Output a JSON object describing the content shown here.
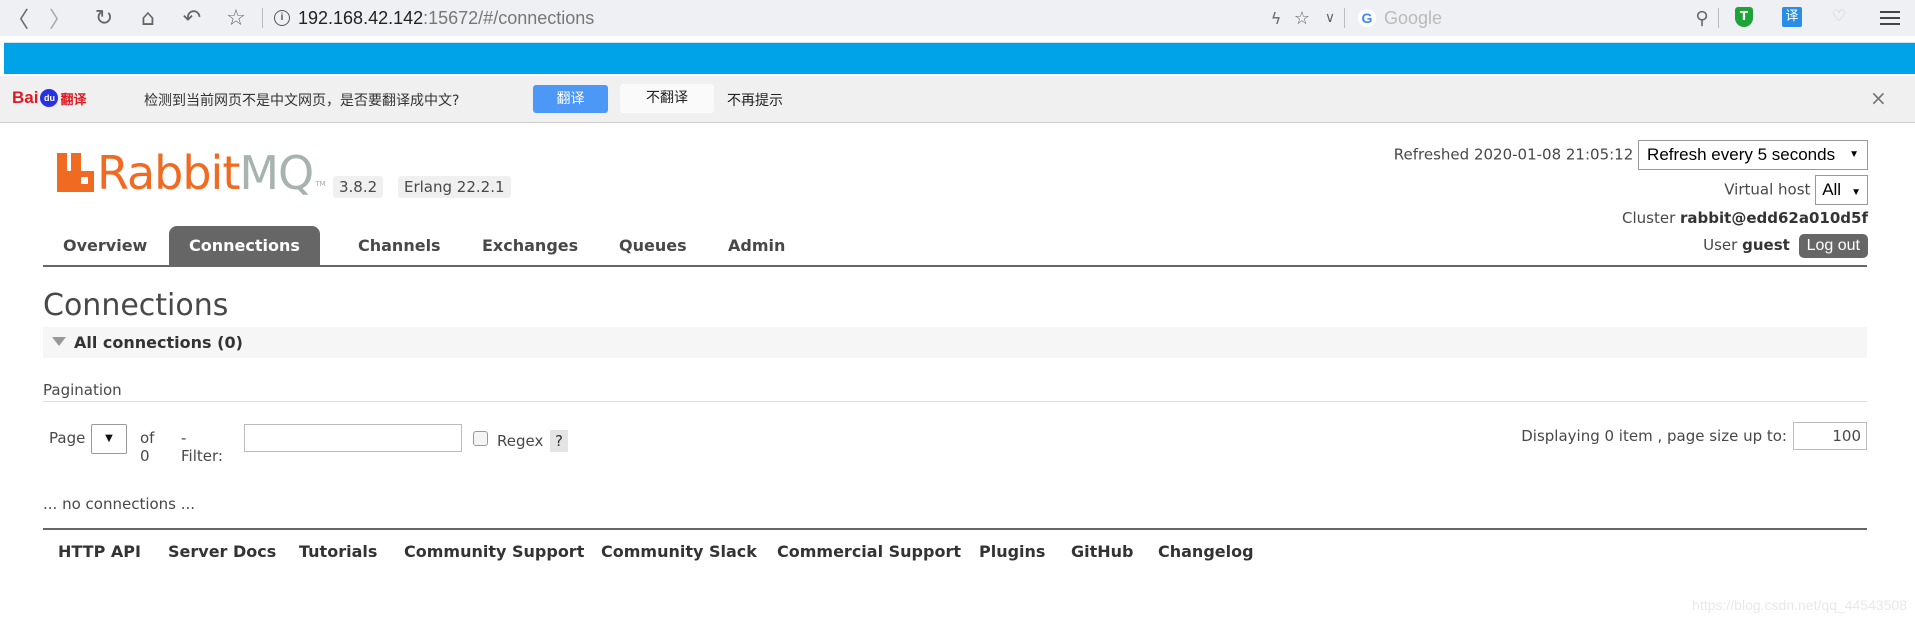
{
  "browser": {
    "url_host": "192.168.42.142",
    "url_rest": ":15672/#/connections",
    "search_placeholder": "Google",
    "icons": [
      "back-icon",
      "forward-icon",
      "reload-icon",
      "home-icon",
      "undo-icon",
      "bookmark-star-icon",
      "info-icon",
      "lightning-icon",
      "star-icon",
      "chevron-down-icon",
      "google-icon",
      "search-icon",
      "shield-extension-icon",
      "translate-extension-icon",
      "pocket-extension-icon",
      "menu-icon"
    ],
    "ext_shield_label": "T",
    "ext_translate_label": "译"
  },
  "translate_bar": {
    "logo_bai": "Bai",
    "logo_du": "du",
    "logo_fanyi": "翻译",
    "message": "检测到当前网页不是中文网页，是否要翻译成中文?",
    "translate_label": "翻译",
    "no_translate_label": "不翻译",
    "never_prompt_label": "不再提示",
    "close_glyph": "×"
  },
  "app": {
    "logo_rabbit": "Rabbit",
    "logo_mq": "MQ",
    "logo_tm": "TM",
    "version": "3.8.2",
    "erlang": "Erlang 22.2.1"
  },
  "status": {
    "refreshed_label": "Refreshed 2020-01-08 21:05:12",
    "refresh_select": "Refresh every 5 seconds",
    "vhost_label": "Virtual host",
    "vhost_select": "All",
    "cluster_label": "Cluster",
    "cluster_value": "rabbit@edd62a010d5f",
    "user_label": "User",
    "user_value": "guest",
    "logout_label": "Log out"
  },
  "tabs": [
    {
      "label": "Overview",
      "active": false
    },
    {
      "label": "Connections",
      "active": true
    },
    {
      "label": "Channels",
      "active": false
    },
    {
      "label": "Exchanges",
      "active": false
    },
    {
      "label": "Queues",
      "active": false
    },
    {
      "label": "Admin",
      "active": false
    }
  ],
  "main": {
    "title": "Connections",
    "section_label": "All connections (0)",
    "pagination_label": "Pagination",
    "page_label": "Page",
    "page_select": "",
    "of_label": "of 0",
    "filter_label": "- Filter:",
    "filter_value": "",
    "regex_label": "Regex",
    "regex_checked": false,
    "help_label": "?",
    "displaying_label": "Displaying 0 item , page size up to:",
    "page_size": "100",
    "empty_message": "... no connections ..."
  },
  "footer": {
    "links": [
      "HTTP API",
      "Server Docs",
      "Tutorials",
      "Community Support",
      "Community Slack",
      "Commercial Support",
      "Plugins",
      "GitHub",
      "Changelog"
    ]
  },
  "watermark": "https://blog.csdn.net/qq_44543508"
}
